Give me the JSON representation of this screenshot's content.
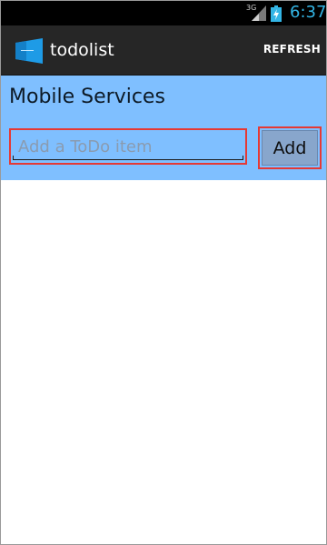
{
  "status_bar": {
    "network": "3G",
    "time": "6:37",
    "icons": [
      "signal-icon",
      "battery-charging-icon"
    ]
  },
  "action_bar": {
    "title": "todolist",
    "app_icon": "azure-mobile-app-icon",
    "refresh_label": "REFRESH"
  },
  "header": {
    "title": "Mobile Services",
    "input_placeholder": "Add a ToDo item",
    "input_value": "",
    "add_label": "Add"
  },
  "todo_items": [],
  "colors": {
    "status_accent": "#33b5e5",
    "action_bar_bg": "#262626",
    "header_bg": "#7fbfff",
    "highlight_border": "#e53935",
    "add_button_bg": "#88a6cc"
  }
}
